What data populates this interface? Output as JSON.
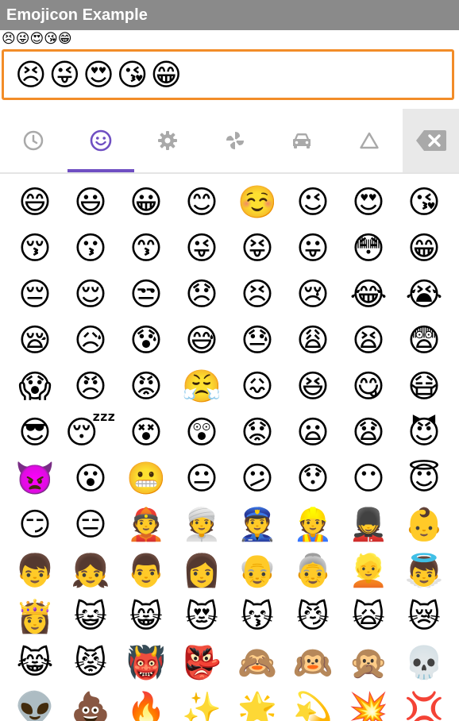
{
  "app": {
    "title": "Emojicon Example"
  },
  "echo": {
    "text": "😣😜😍😘😁"
  },
  "editor": {
    "value": "😣😜😍😘😁"
  },
  "tabs": [
    {
      "name": "tab-recent",
      "icon": "clock-icon",
      "active": false
    },
    {
      "name": "tab-people",
      "icon": "smiley-icon",
      "active": true
    },
    {
      "name": "tab-objects",
      "icon": "gear-icon",
      "active": false
    },
    {
      "name": "tab-nature",
      "icon": "pinwheel-icon",
      "active": false
    },
    {
      "name": "tab-places",
      "icon": "car-icon",
      "active": false
    },
    {
      "name": "tab-symbols",
      "icon": "triangle-icon",
      "active": false
    }
  ],
  "colors": {
    "accent": "#6f4fc2",
    "editor_border": "#f28c28",
    "titlebar": "#8a8a8a",
    "icon_gray": "#a9a9a9"
  },
  "emojis": [
    "😄",
    "😃",
    "😀",
    "😊",
    "☺️",
    "😉",
    "😍",
    "😘",
    "😚",
    "😗",
    "😙",
    "😜",
    "😝",
    "😛",
    "😳",
    "😁",
    "😔",
    "😌",
    "😒",
    "😞",
    "😣",
    "😢",
    "😂",
    "😭",
    "😪",
    "😥",
    "😰",
    "😅",
    "😓",
    "😩",
    "😫",
    "😨",
    "😱",
    "😠",
    "😡",
    "😤",
    "😖",
    "😆",
    "😋",
    "😷",
    "😎",
    "😴",
    "😵",
    "😲",
    "😟",
    "😦",
    "😧",
    "😈",
    "👿",
    "😮",
    "😬",
    "😐",
    "😕",
    "😯",
    "😶",
    "😇",
    "😏",
    "😑",
    "👲",
    "👳",
    "👮",
    "👷",
    "💂",
    "👶",
    "👦",
    "👧",
    "👨",
    "👩",
    "👴",
    "👵",
    "👱",
    "👼",
    "👸",
    "😺",
    "😸",
    "😻",
    "😽",
    "😼",
    "🙀",
    "😿",
    "😹",
    "😾",
    "👹",
    "👺",
    "🙈",
    "🙉",
    "🙊",
    "💀",
    "👽",
    "💩",
    "🔥",
    "✨",
    "🌟",
    "💫",
    "💥",
    "💢"
  ]
}
